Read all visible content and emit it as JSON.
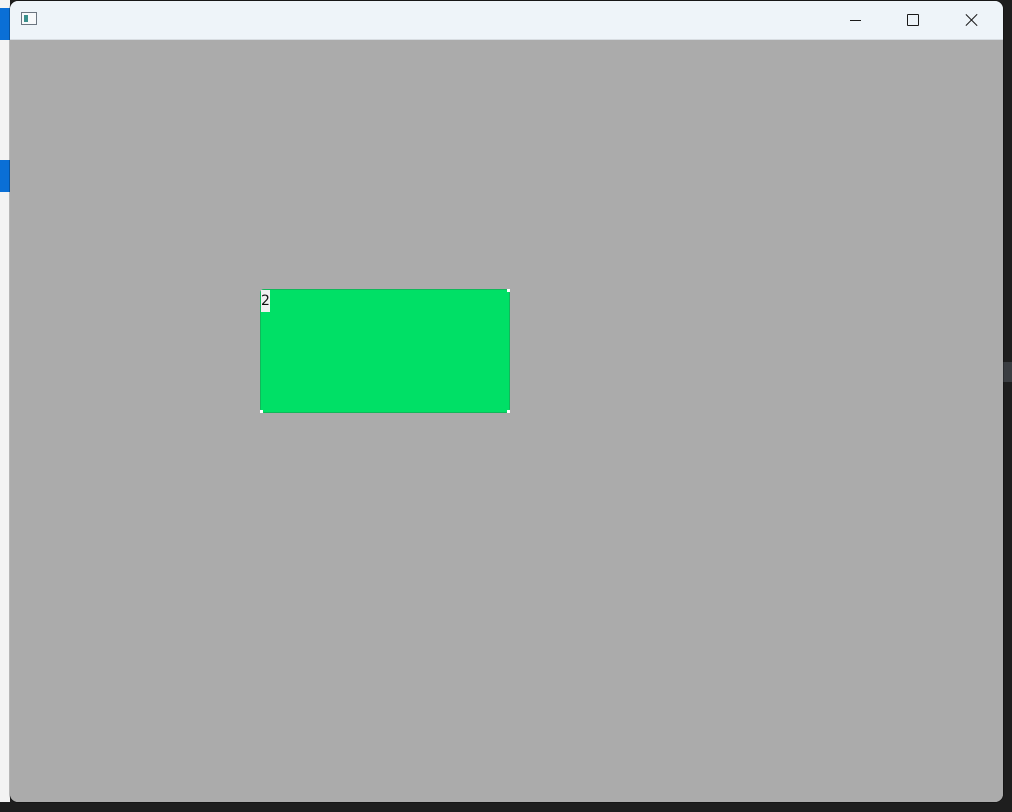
{
  "window": {
    "title": "",
    "controls": {
      "minimize": "minimize",
      "maximize": "maximize",
      "close": "close"
    }
  },
  "canvas": {
    "background_color": "#ababab",
    "item": {
      "label": "2",
      "fill_color": "#00e066",
      "border_color": "#10b85a"
    }
  },
  "icons": {
    "app": "app-window-icon",
    "minimize": "minimize-icon",
    "maximize": "maximize-icon",
    "close": "close-icon"
  }
}
